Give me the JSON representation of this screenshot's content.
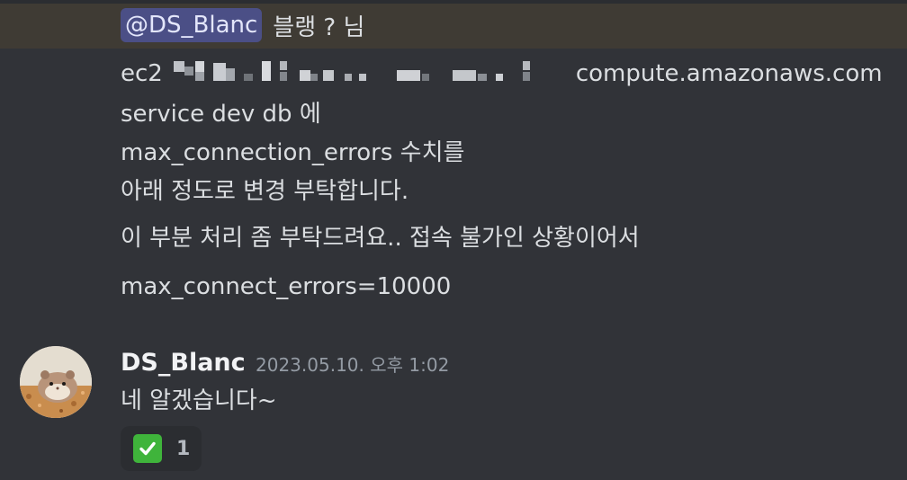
{
  "mention_message": {
    "mention": "@DS_Blanc",
    "text": "블랭 ? 님"
  },
  "message_lines": {
    "host_prefix": "ec2",
    "host_suffix": "compute.amazonaws.com",
    "line2": "service dev db 에",
    "line3": "max_connection_errors 수치를",
    "line4": "아래 정도로 변경 부탁합니다.",
    "line5": "이 부분 처리 좀 부탁드려요.. 접속 불가인 상황이어서",
    "line6": "max_connect_errors=10000"
  },
  "reply": {
    "username": "DS_Blanc",
    "timestamp": "2023.05.10. 오후 1:02",
    "text": "네 알겠습니다~"
  },
  "reaction": {
    "emoji": "check-mark-icon",
    "count": "1"
  },
  "colors": {
    "background": "#313338",
    "mention_highlight": "#3f3b34",
    "mention_pill": "#4b4f86",
    "reaction_bg": "#2b2d31",
    "check_green": "#3fb43b"
  }
}
